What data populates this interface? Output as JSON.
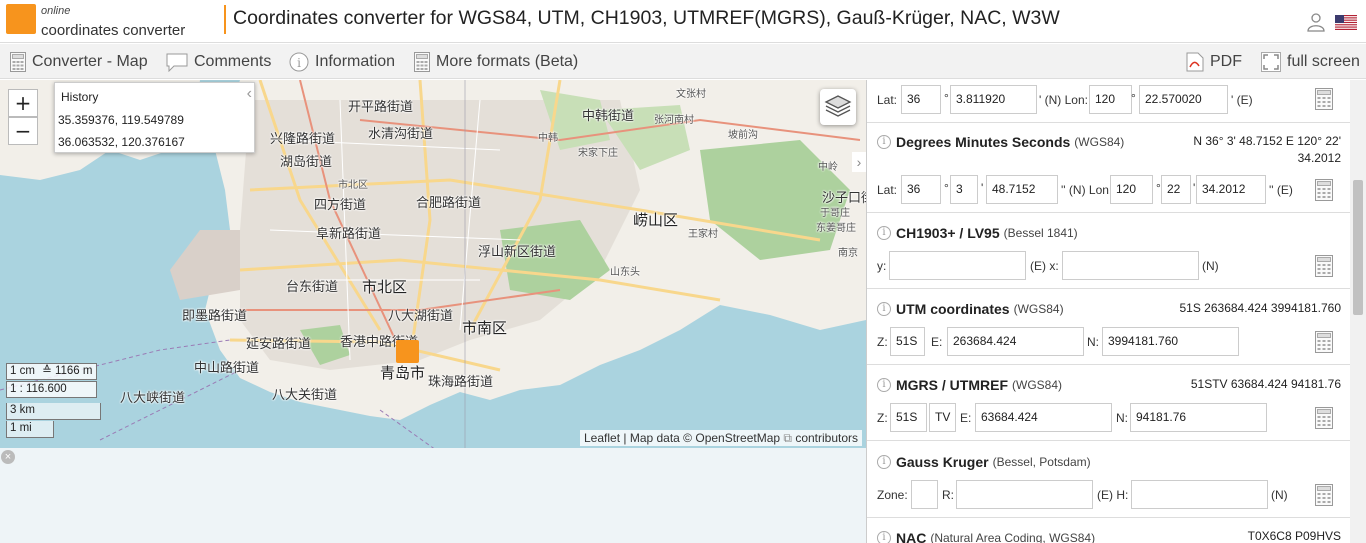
{
  "header": {
    "logo_line1": "online",
    "logo_line2": "coordinates converter",
    "title": "Coordinates converter for WGS84, UTM, CH1903, UTMREF(MGRS), Gauß-Krüger, NAC, W3W",
    "user_icon": "user-icon",
    "language_icon": "us-flag-icon"
  },
  "nav": {
    "converter_map": "Converter - Map",
    "comments": "Comments",
    "information": "Information",
    "more_formats": "More formats (Beta)",
    "pdf": "PDF",
    "full_screen": "full screen"
  },
  "map": {
    "zoom_in": "+",
    "zoom_out": "−",
    "history_title": "History",
    "history_items": [
      "35.359376, 119.549789",
      "36.063532, 120.376167"
    ],
    "scale_cm": "1 cm",
    "scale_eq": "≙ 1166 m",
    "scale_ratio": "1 : 116.600",
    "scale_km": "3 km",
    "scale_mi": "1 mi",
    "attribution_leaflet": "Leaflet",
    "attribution_sep": " | Map data © OpenStreetMap ",
    "attribution_contrib": "contributors",
    "places": {
      "p1": "开平路街道",
      "p2": "兴隆路街道",
      "p3": "水清沟街道",
      "p4": "湖岛街道",
      "p5": "市北区",
      "p6": "四方街道",
      "p7": "合肥路街道",
      "p8": "阜新路街道",
      "p9": "浮山新区街道",
      "p10": "台东街道",
      "p11": "市北区",
      "p12": "八大湖街道",
      "p13": "即墨路街道",
      "p14": "延安路街道",
      "p15": "香港中路街道",
      "p16": "市南区",
      "p17": "中山路街道",
      "p18": "青岛市",
      "p19": "珠海路街道",
      "p20": "八大峡街道",
      "p21": "八大关街道",
      "p22": "中韩街道",
      "p23": "崂山区",
      "p24": "沙子口街",
      "p25": "张河南村",
      "p26": "文张村",
      "p27": "坡前沟",
      "p28": "宋家下庄",
      "p29": "中韩",
      "p30": "王家村",
      "p31": "山东头",
      "p32": "南京",
      "p33": "东姜哥庄",
      "p34": "中岭",
      "p35": "于哥庄"
    }
  },
  "panel": {
    "dd": {
      "lat_label": "Lat:",
      "lat_deg": "36",
      "deg_sym": "°",
      "lat_min": "3.811920",
      "lat_min_sym": "' (N) Lon:",
      "lon_deg": "120",
      "lon_min": "22.570020",
      "lon_min_sym": "' (E)"
    },
    "dms": {
      "title": "Degrees Minutes Seconds",
      "sub": "(WGS84)",
      "value_line1": "N 36° 3' 48.7152 E 120° 22'",
      "value_line2": "34.2012",
      "lat_label": "Lat:",
      "lat_deg": "36",
      "lat_min": "3",
      "lat_sec": "48.7152",
      "lat_sec_sym": "'' (N) Lon:",
      "lon_deg": "120",
      "lon_min": "22",
      "lon_sec": "34.2012",
      "lon_sec_sym": "'' (E)",
      "deg_sym": "°",
      "min_sym": "'"
    },
    "ch1903": {
      "title": "CH1903+ / LV95",
      "sub": "(Bessel 1841)",
      "y_label": "y:",
      "y_value": "",
      "e_label": "(E) x:",
      "x_value": "",
      "n_label": "(N)"
    },
    "utm": {
      "title": "UTM coordinates",
      "sub": "(WGS84)",
      "value": "51S 263684.424 3994181.760",
      "z_label": "Z:",
      "z_value": "51S",
      "e_label": "E:",
      "e_value": "263684.424",
      "n_label": "N:",
      "n_value": "3994181.760"
    },
    "mgrs": {
      "title": "MGRS / UTMREF",
      "sub": "(WGS84)",
      "value": "51STV 63684.424 94181.76",
      "z_label": "Z:",
      "z_value": "51S",
      "sq_value": "TV",
      "e_label": "E:",
      "e_value": "63684.424",
      "n_label": "N:",
      "n_value": "94181.76"
    },
    "gk": {
      "title": "Gauss Kruger",
      "sub": "(Bessel, Potsdam)",
      "zone_label": "Zone:",
      "zone_value": "",
      "r_label": "R:",
      "r_value": "",
      "e_label": "(E) H:",
      "h_value": "",
      "n_label": "(N)"
    },
    "nac": {
      "title": "NAC",
      "sub": "(Natural Area Coding, WGS84)",
      "value": "T0X6C8 P09HVS"
    }
  },
  "colors": {
    "accent": "#f7941d",
    "water": "#aad3df",
    "land": "#f2efe9",
    "green": "#add19e"
  }
}
